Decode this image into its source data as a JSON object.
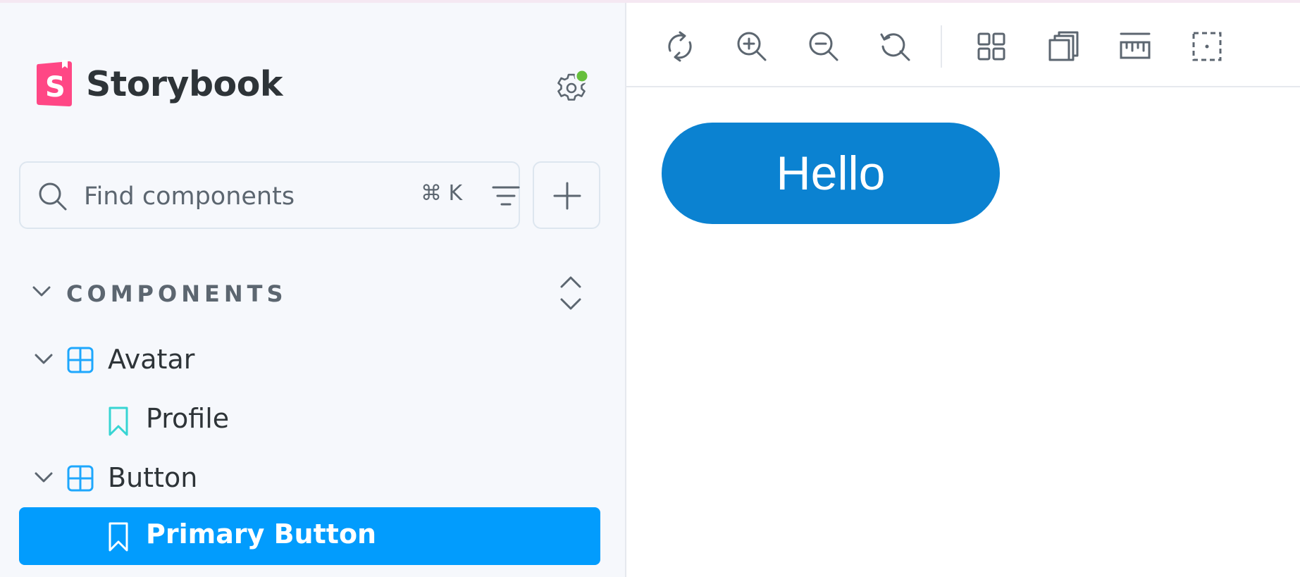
{
  "brand": {
    "name": "Storybook",
    "logo_letter": "S"
  },
  "colors": {
    "brand_pink": "#ff4785",
    "selected_blue": "#029cfd",
    "component_icon": "#1ea7fd",
    "story_icon": "#37d5d3",
    "status_green": "#66bf3c",
    "preview_button": "#0b82d1"
  },
  "sidebar": {
    "settings_icon": "gear-icon",
    "search": {
      "placeholder": "Find components",
      "shortcut": "⌘ K"
    },
    "section_title": "COMPONENTS",
    "tree": [
      {
        "type": "component",
        "label": "Avatar",
        "expanded": true
      },
      {
        "type": "story",
        "label": "Profile",
        "selected": false
      },
      {
        "type": "component",
        "label": "Button",
        "expanded": true
      },
      {
        "type": "story",
        "label": "Primary Button",
        "selected": true
      }
    ]
  },
  "toolbar": {
    "tools": [
      "reload-icon",
      "zoom-in-icon",
      "zoom-out-icon",
      "zoom-reset-icon",
      "grid-icon",
      "background-icon",
      "measure-icon",
      "outline-icon"
    ]
  },
  "preview": {
    "button_label": "Hello"
  }
}
